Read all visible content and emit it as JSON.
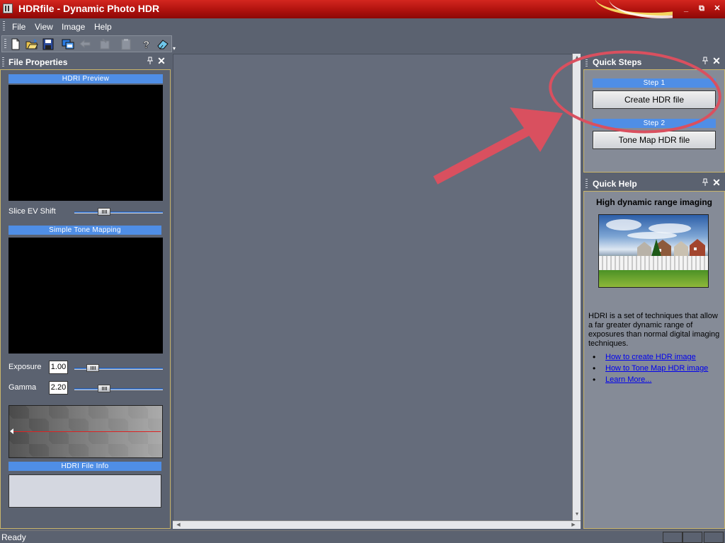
{
  "window": {
    "title": "HDRfile - Dynamic Photo HDR",
    "controls": {
      "minimize": "_",
      "restore": "⧉",
      "close": "✕"
    }
  },
  "menu": {
    "items": [
      {
        "label": "File"
      },
      {
        "label": "View"
      },
      {
        "label": "Image"
      },
      {
        "label": "Help"
      }
    ]
  },
  "toolbar": {
    "buttons": [
      {
        "icon": "new-file-icon",
        "enabled": true
      },
      {
        "icon": "open-folder-icon",
        "enabled": true
      },
      {
        "icon": "save-icon",
        "enabled": true
      },
      {
        "icon": "copy-windows-icon",
        "enabled": true
      },
      {
        "icon": "back-arrow-icon",
        "enabled": false
      },
      {
        "icon": "import-icon",
        "enabled": false
      },
      {
        "icon": "clipboard-icon",
        "enabled": false
      },
      {
        "icon": "help-icon",
        "enabled": true
      },
      {
        "icon": "eraser-icon",
        "enabled": true
      }
    ]
  },
  "file_properties": {
    "title": "File Properties",
    "hdri_preview_label": "HDRI Preview",
    "slice_ev_shift_label": "Slice EV Shift",
    "slice_ev_shift_level": 0.31,
    "simple_tone_mapping_label": "Simple Tone Mapping",
    "exposure_label": "Exposure",
    "exposure_value": "1.00",
    "exposure_level": 0.16,
    "gamma_label": "Gamma",
    "gamma_value": "2.20",
    "gamma_level": 0.31,
    "hdri_file_info_label": "HDRI File Info"
  },
  "quick_steps": {
    "title": "Quick Steps",
    "step1_label": "Step 1",
    "step1_button": "Create HDR file",
    "step2_label": "Step 2",
    "step2_button": "Tone Map HDR file"
  },
  "quick_help": {
    "title": "Quick Help",
    "heading": "High dynamic range imaging",
    "description": "HDRI is a set of techniques that allow a far greater dynamic range of exposures than normal digital imaging techniques.",
    "links": [
      {
        "label": "How to create HDR image"
      },
      {
        "label": "How to Tone Map HDR image"
      },
      {
        "label": "Learn More..."
      }
    ]
  },
  "status": {
    "text": "Ready"
  },
  "colors": {
    "title_bar": "#b0120e",
    "panel_bg": "#5b6270",
    "section_bar": "#4f8ee6",
    "annotation": "#d9505f"
  }
}
